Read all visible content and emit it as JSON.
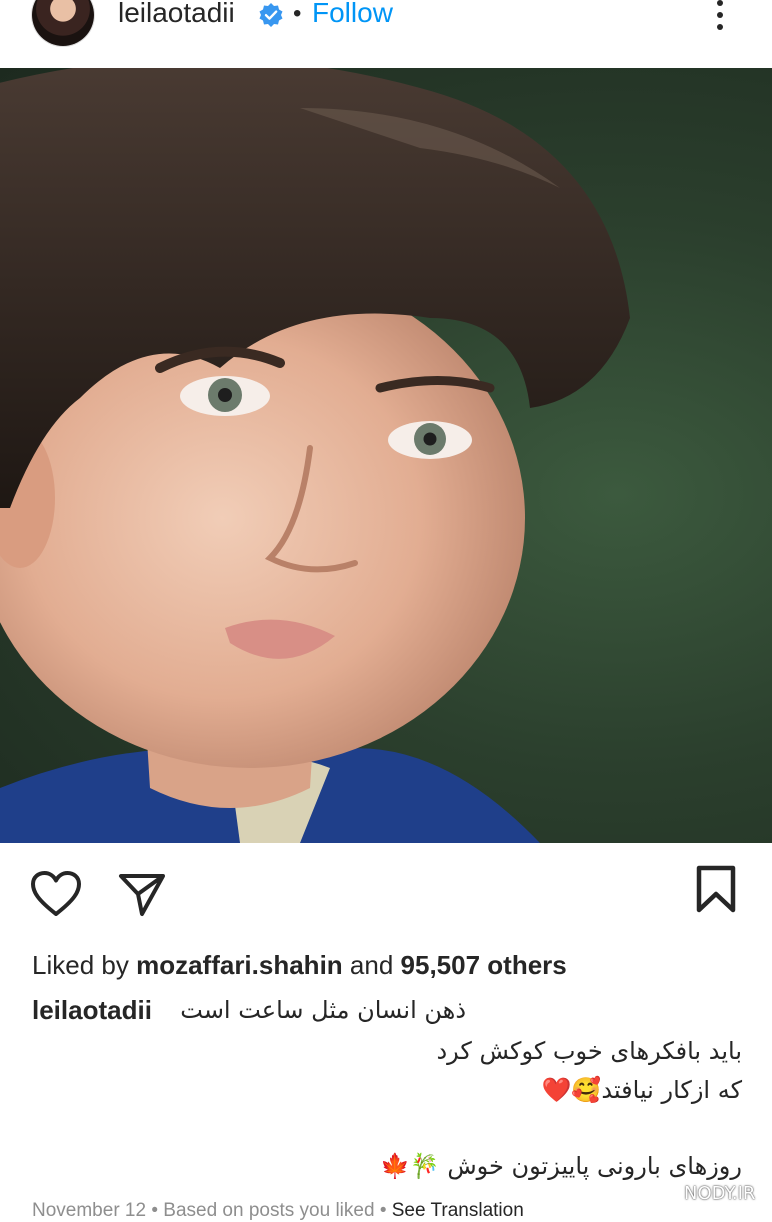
{
  "post_header": {
    "username": "leilaotadii",
    "verified_icon": "verified-badge-icon",
    "separator": "•",
    "follow_label": "Follow",
    "more_icon": "more-vertical-icon"
  },
  "actions": {
    "like_icon": "heart-icon",
    "share_icon": "paper-plane-icon",
    "save_icon": "bookmark-icon"
  },
  "likes": {
    "prefix": "Liked by",
    "user": "mozaffari.shahin",
    "middle": "and",
    "count": "95,507 others"
  },
  "caption": {
    "username": "leilaotadii",
    "line1": "ذهن انسان مثل ساعت است",
    "line2": "باید بافکرهای خوب کوکش کرد",
    "line3": "که ازکار نیافتد🥰❤️",
    "line4": "روزهای بارونی پاییزتون خوش 🎋🍁"
  },
  "meta": {
    "date": "November 12",
    "sep1": "•",
    "based": "Based on posts you liked",
    "sep2": "•",
    "translation": "See Translation"
  },
  "watermark": "NODY.IR",
  "colors": {
    "follow": "#0095f6",
    "text": "#262626",
    "secondary": "#8e8e8e",
    "verified": "#3897f0"
  }
}
